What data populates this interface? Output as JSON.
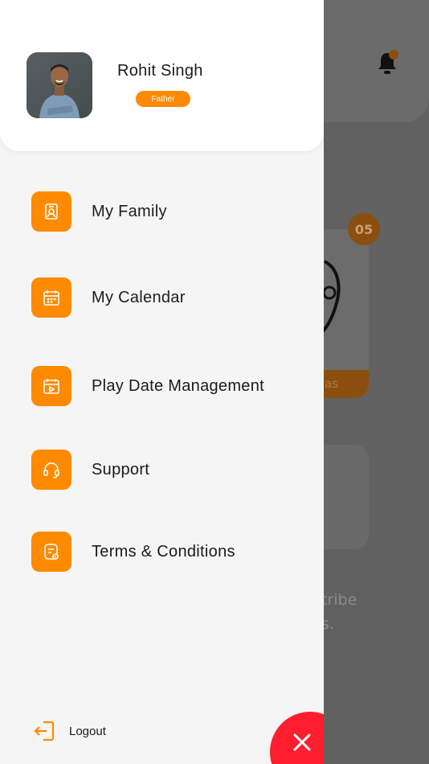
{
  "background": {
    "badge_count": "05",
    "card_button_fragment": "as",
    "text_line1_fragment": "tribe",
    "text_line2_fragment": "s."
  },
  "profile": {
    "name": "Rohit Singh",
    "role": "Father"
  },
  "menu": [
    {
      "label": "My Family",
      "icon": "family-icon"
    },
    {
      "label": "My Calendar",
      "icon": "calendar-icon"
    },
    {
      "label": "Play Date Management",
      "icon": "play-date-icon"
    },
    {
      "label": "Support",
      "icon": "headset-icon"
    },
    {
      "label": "Terms & Conditions",
      "icon": "terms-icon"
    }
  ],
  "logout": {
    "label": "Logout",
    "icon": "logout-icon"
  },
  "colors": {
    "accent": "#FF8A00",
    "close_button": "#FF1E2D",
    "drawer_bg": "#F5F5F5"
  }
}
